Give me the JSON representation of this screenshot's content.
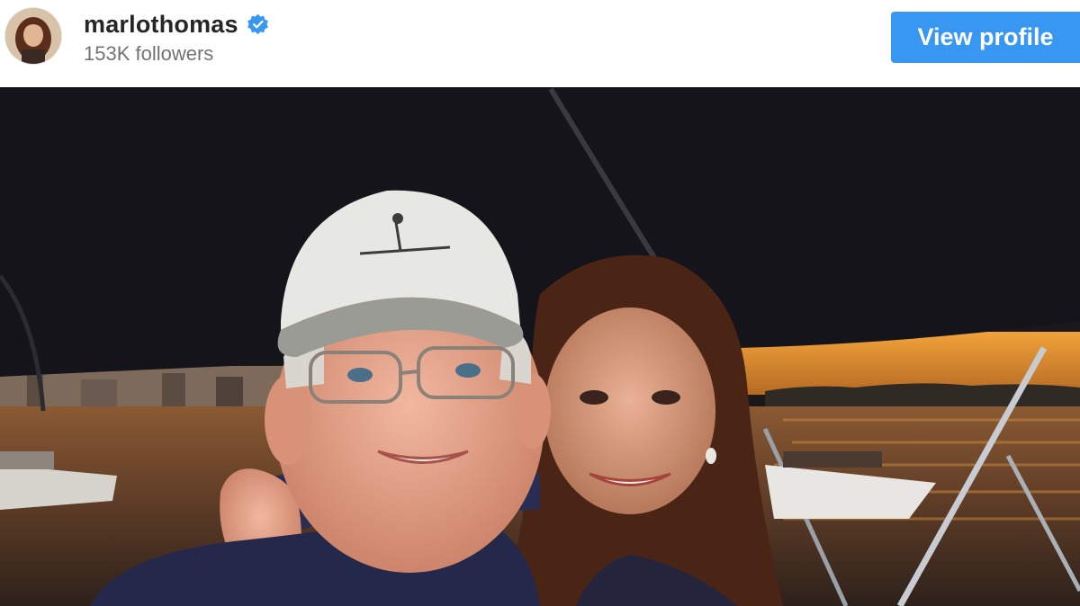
{
  "post_header": {
    "username": "marlothomas",
    "verified": true,
    "followers": "153K followers",
    "avatar_icon": "profile-avatar",
    "verified_icon": "verified-badge-icon",
    "view_profile_label": "View profile",
    "accent_color": "#3897f0"
  },
  "photo": {
    "description_icon": "post-photo"
  }
}
